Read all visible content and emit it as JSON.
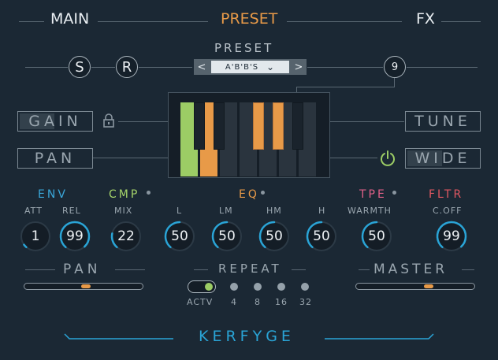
{
  "nav": {
    "main": "MAIN",
    "preset": "PRESET",
    "fx": "FX"
  },
  "preset": {
    "label": "PRESET",
    "s_label": "S",
    "r_label": "R",
    "prev": "<",
    "next": ">",
    "name": "A'B'B'S",
    "dropdown": "⌄",
    "count": "9"
  },
  "left_buttons": {
    "gain": "GAIN",
    "pan": "PAN"
  },
  "right_buttons": {
    "tune": "TUNE",
    "wide": "WIDE"
  },
  "sections": {
    "env": "ENV",
    "cmp": "CMP",
    "eq": "EQ",
    "tpe": "TPE",
    "fltr": "FLTR"
  },
  "knobs": [
    {
      "label": "ATT",
      "value": "1",
      "level": 0.05
    },
    {
      "label": "REL",
      "value": "99",
      "level": 0.99
    },
    {
      "label": "MIX",
      "value": "22",
      "level": 0.22
    },
    {
      "label": "L",
      "value": "50",
      "level": 0.5
    },
    {
      "label": "LM",
      "value": "50",
      "level": 0.5
    },
    {
      "label": "HM",
      "value": "50",
      "level": 0.5
    },
    {
      "label": "H",
      "value": "50",
      "level": 0.5
    },
    {
      "label": "WARMTH",
      "value": "50",
      "level": 0.5
    },
    {
      "label": "C.OFF",
      "value": "99",
      "level": 0.99
    }
  ],
  "bottom": {
    "pan_label": "PAN",
    "pan_level": 0.52,
    "repeat_label": "REPEAT",
    "actv": "ACTV",
    "repeat_values": [
      "4",
      "8",
      "16",
      "32"
    ],
    "master_label": "MASTER",
    "master_level": 0.62
  },
  "footer": {
    "brand": "KERFYGE"
  },
  "colors": {
    "accent_orange": "#e89a48",
    "accent_blue": "#2aa4d6",
    "green": "#9ccc65",
    "env_blue": "#3aa6d8",
    "cmp_green": "#a5d36a",
    "tpe_pink": "#e06088",
    "fltr_red": "#e05862"
  }
}
